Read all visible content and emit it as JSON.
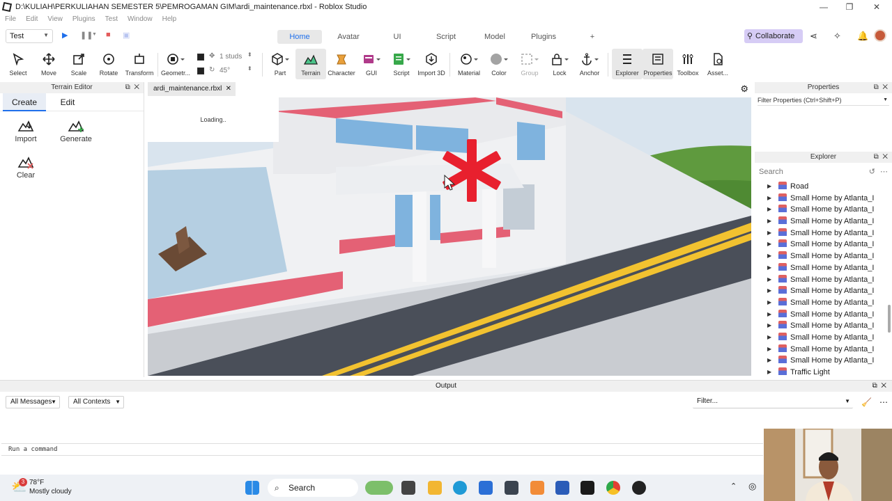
{
  "window": {
    "title": "D:\\KULIAH\\PERKULIAHAN SEMESTER 5\\PEMROGAMAN GIM\\ardi_maintenance.rbxl - Roblox Studio"
  },
  "menu": [
    "File",
    "Edit",
    "View",
    "Plugins",
    "Test",
    "Window",
    "Help"
  ],
  "test_selector": "Test",
  "ribbon_tabs": [
    "Home",
    "Avatar",
    "UI",
    "Script",
    "Model",
    "Plugins",
    "+"
  ],
  "collaborate": "Collaborate",
  "tools": {
    "select": "Select",
    "move": "Move",
    "scale": "Scale",
    "rotate": "Rotate",
    "transform": "Transform",
    "geometry": "Geometr...",
    "studs": "1 studs",
    "degrees": "45°",
    "part": "Part",
    "terrain": "Terrain",
    "character": "Character",
    "gui": "GUI",
    "script": "Script",
    "import3d": "Import 3D",
    "material": "Material",
    "color": "Color",
    "group": "Group",
    "lock": "Lock",
    "anchor": "Anchor",
    "explorer": "Explorer",
    "properties": "Properties",
    "toolbox": "Toolbox",
    "assets": "Asset..."
  },
  "terrain_editor": {
    "title": "Terrain Editor",
    "tabs": [
      "Create",
      "Edit"
    ],
    "buttons": [
      "Import",
      "Generate",
      "Clear"
    ]
  },
  "doc_tab": "ardi_maintenance.rbxl",
  "viewport": {
    "loading": "Loading.."
  },
  "properties": {
    "title": "Properties",
    "filter_placeholder": "Filter Properties (Ctrl+Shift+P)"
  },
  "explorer": {
    "title": "Explorer",
    "search_placeholder": "Search",
    "items": [
      "Road",
      "Small Home by Atlanta_I",
      "Small Home by Atlanta_I",
      "Small Home by Atlanta_I",
      "Small Home by Atlanta_I",
      "Small Home by Atlanta_I",
      "Small Home by Atlanta_I",
      "Small Home by Atlanta_I",
      "Small Home by Atlanta_I",
      "Small Home by Atlanta_I",
      "Small Home by Atlanta_I",
      "Small Home by Atlanta_I",
      "Small Home by Atlanta_I",
      "Small Home by Atlanta_I",
      "Small Home by Atlanta_I",
      "Small Home by Atlanta_I",
      "Traffic Light"
    ]
  },
  "output": {
    "title": "Output",
    "messages_filter": "All Messages",
    "contexts_filter": "All Contexts",
    "filter_placeholder": "Filter...",
    "command_placeholder": "Run a command"
  },
  "taskbar": {
    "weather_badge": "3",
    "temperature": "78°F",
    "condition": "Mostly cloudy",
    "search": "Search"
  }
}
